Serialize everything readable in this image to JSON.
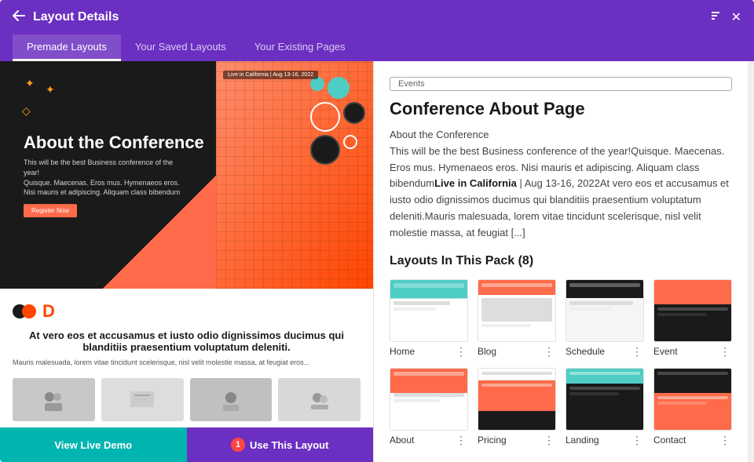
{
  "header": {
    "title": "Layout Details",
    "back_icon": "←",
    "sort_icon": "↕",
    "close_icon": "✕"
  },
  "tabs": [
    {
      "id": "premade",
      "label": "Premade Layouts",
      "active": true
    },
    {
      "id": "saved",
      "label": "Your Saved Layouts",
      "active": false
    },
    {
      "id": "existing",
      "label": "Your Existing Pages",
      "active": false
    }
  ],
  "preview": {
    "title": "About the Conference",
    "subtitle": "This will be the best Business conference of the year!",
    "body_text": "Quisque. Maecenas. Eros mus. Hymenaeos eros. Nisi mauris et adipiscing. Aliquam class bibendum",
    "live_banner": "Live in California | Aug 13-16, 2022",
    "register_btn": "Register Now",
    "logo_letter": "D",
    "content_heading": "At vero eos et accusamus et iusto odio dignissimos ducimus qui blanditiis praesentium voluptatum deleniti.",
    "content_body": "Mauris malesuada, lorem vitae tincidunt scelerisque, nisl velit molestie massa, at feugiat eros..."
  },
  "buttons": {
    "demo": "View Live Demo",
    "use_layout": "Use This Layout",
    "badge": "1"
  },
  "detail": {
    "tag": "Events",
    "title": "Conference About Page",
    "description": "About the ConferenceThis will be the best Business conference of the year!Quisque. Maecenas. Eros mus. Hymenaeos eros. Nisi mauris et adipiscing. Aliquam class bibendumLive in California | Aug 13-16, 2022At vero eos et accusamus et iusto odio dignissimos ducimus qui blanditiis praesentium voluptatum deleniti.Mauris malesuada, lorem vitae tincidunt scelerisque, nisl velit molestie massa, at feugiat [...]",
    "pack_title": "Layouts In This Pack (8)"
  },
  "layouts": [
    {
      "id": "home",
      "label": "Home",
      "mockup_class": "mock-home"
    },
    {
      "id": "blog",
      "label": "Blog",
      "mockup_class": "mock-blog"
    },
    {
      "id": "schedule",
      "label": "Schedule",
      "mockup_class": "mock-schedule"
    },
    {
      "id": "event",
      "label": "Event",
      "mockup_class": "mock-event"
    },
    {
      "id": "about",
      "label": "About",
      "mockup_class": "mock-about"
    },
    {
      "id": "registration",
      "label": "Pricing",
      "mockup_class": "mock-registration"
    },
    {
      "id": "landing",
      "label": "Landing",
      "mockup_class": "mock-landing"
    },
    {
      "id": "contact",
      "label": "Contact",
      "mockup_class": "mock-contact"
    }
  ],
  "colors": {
    "header_bg": "#6B2FC1",
    "teal": "#00b5b0",
    "orange": "#ff6b4a"
  }
}
